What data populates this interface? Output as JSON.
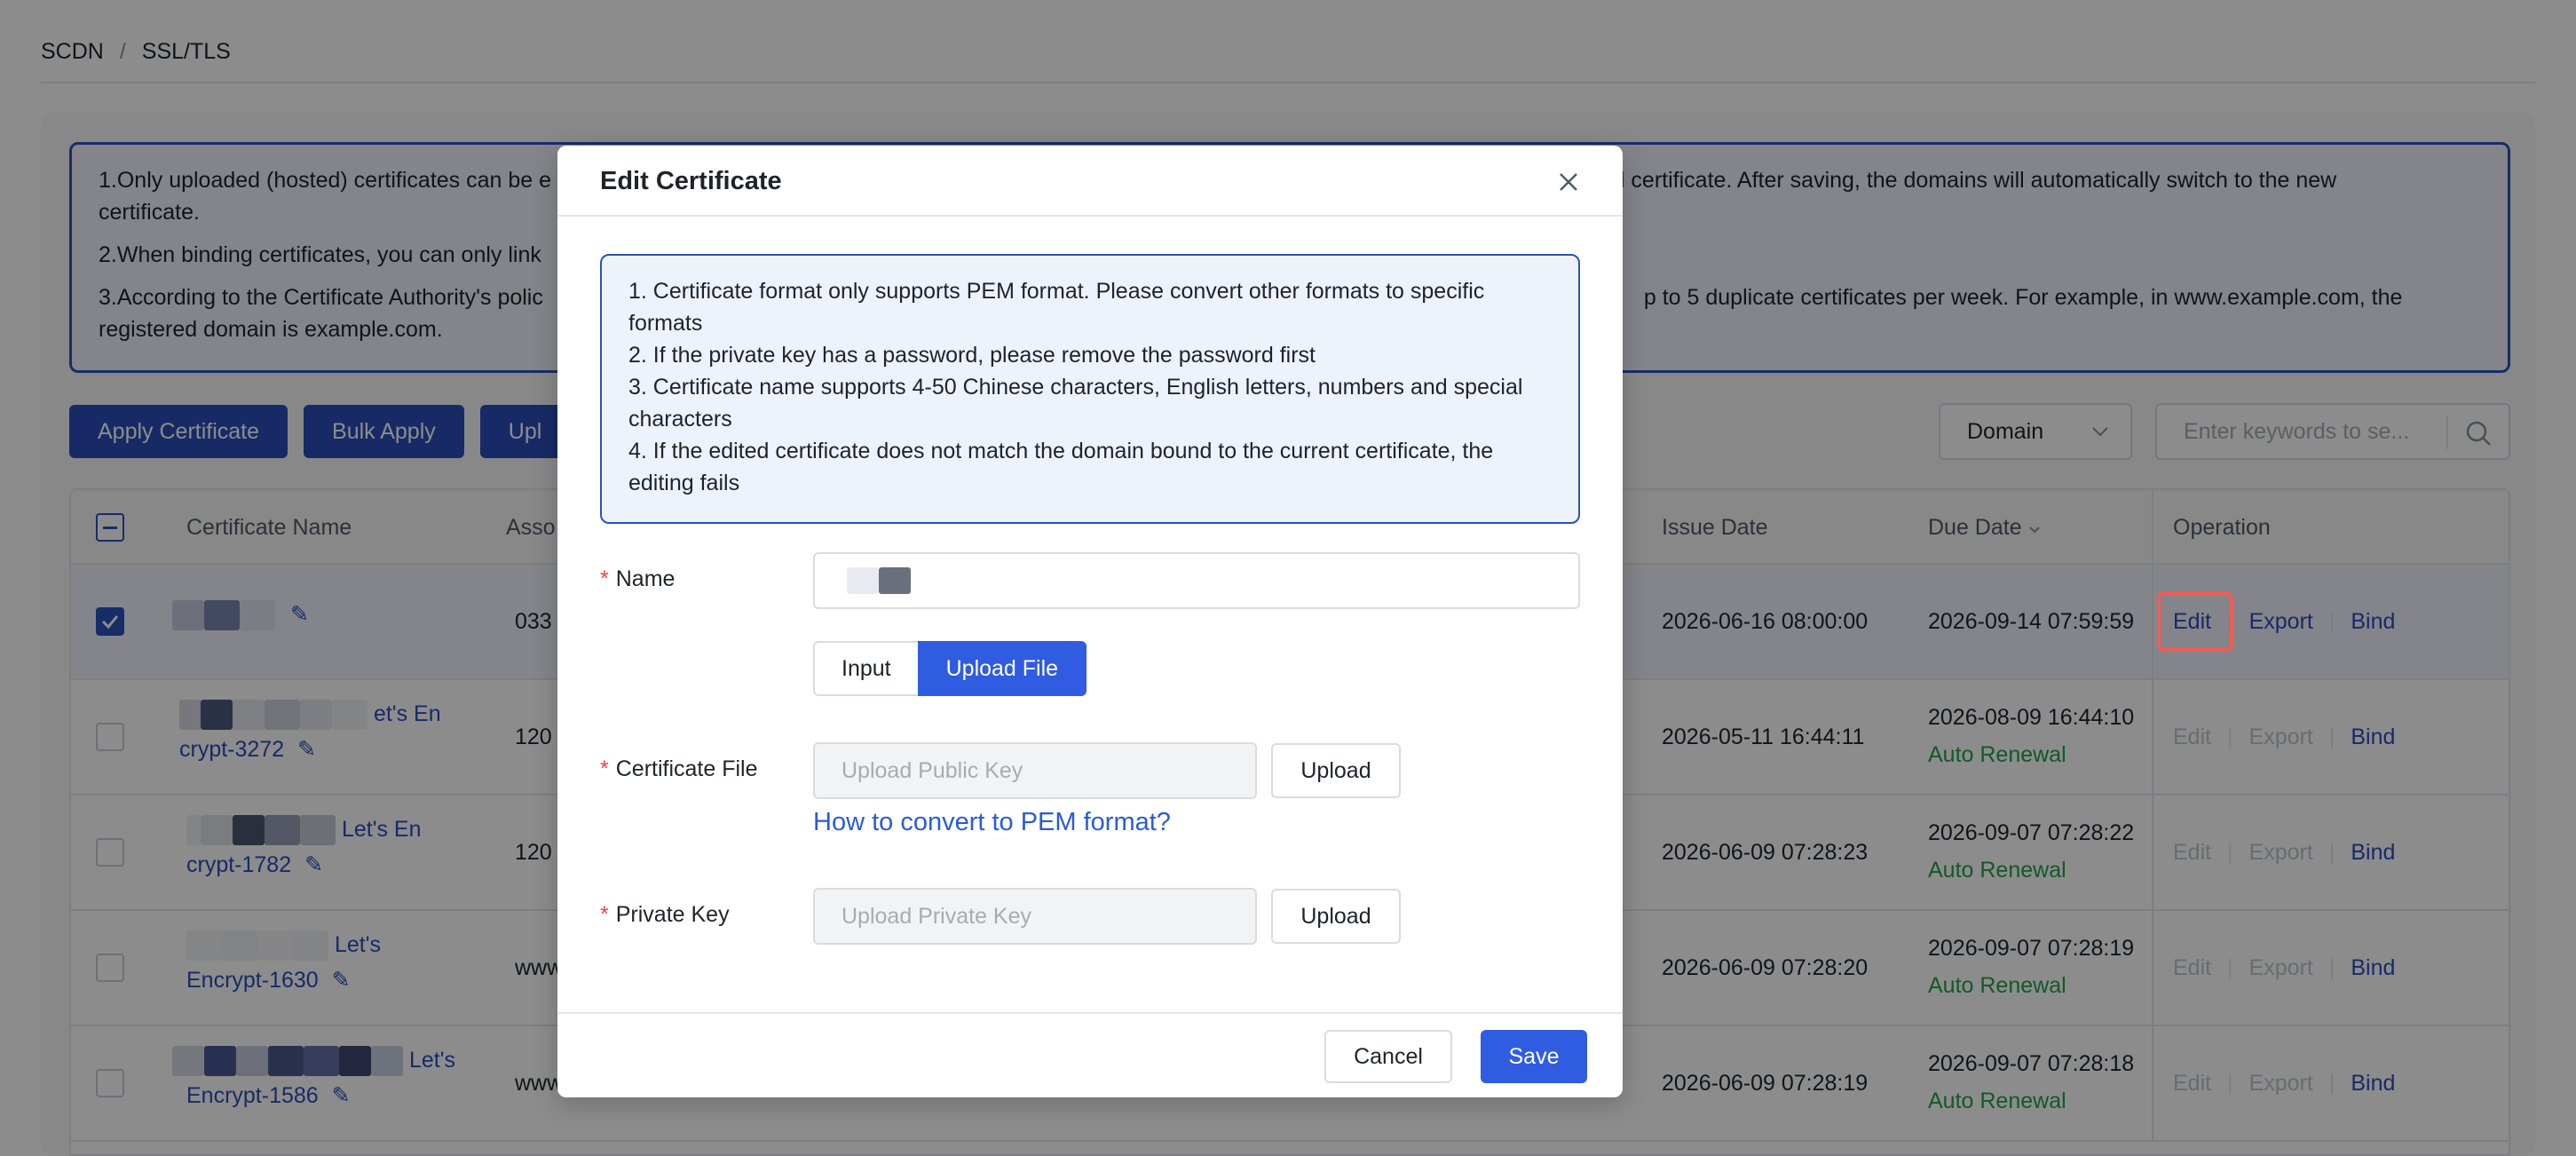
{
  "breadcrumb": {
    "root": "SCDN",
    "separator": "/",
    "current": "SSL/TLS"
  },
  "notice": {
    "line1_start": "1.Only uploaded (hosted) certificates can be e",
    "line1_end": "al certificate. After saving, the domains will automatically switch to the new",
    "line1_cont": "certificate.",
    "line2_start": "2.When binding certificates, you can only link",
    "line3_start": "3.According to the Certificate Authority's polic",
    "line3_end": "p to 5 duplicate certificates per week. For example, in www.example.com, the",
    "line3_cont": "registered domain is example.com."
  },
  "toolbar": {
    "apply_label": "Apply Certificate",
    "bulk_label": "Bulk Apply",
    "upload_label_partial": "Upl",
    "filter_value": "Domain",
    "search_placeholder": "Enter keywords to se..."
  },
  "table": {
    "headers": {
      "name": "Certificate Name",
      "associated": "Asso",
      "issue": "Issue Date",
      "due": "Due Date",
      "operation": "Operation"
    },
    "rows": [
      {
        "name_line1": "",
        "name_line2": "",
        "assoc": "033",
        "issue": "2026-06-16 08:00:00",
        "due": "2026-09-14 07:59:59",
        "renewal": "",
        "edit": "Edit",
        "export": "Export",
        "bind": "Bind",
        "selected": true
      },
      {
        "name_line1": "et's En",
        "name_line2": "crypt-3272",
        "assoc": "120",
        "issue": "2026-05-11 16:44:11",
        "due": "2026-08-09 16:44:10",
        "renewal": "Auto Renewal",
        "edit": "Edit",
        "export": "Export",
        "bind": "Bind",
        "selected": false
      },
      {
        "name_line1": "Let's En",
        "name_line2": "crypt-1782",
        "assoc": "120",
        "issue": "2026-06-09 07:28:23",
        "due": "2026-09-07 07:28:22",
        "renewal": "Auto Renewal",
        "edit": "Edit",
        "export": "Export",
        "bind": "Bind",
        "selected": false
      },
      {
        "name_line1": "Let's",
        "name_line2": "Encrypt-1630",
        "assoc": "www",
        "issue": "2026-06-09 07:28:20",
        "due": "2026-09-07 07:28:19",
        "renewal": "Auto Renewal",
        "edit": "Edit",
        "export": "Export",
        "bind": "Bind",
        "selected": false
      },
      {
        "name_line1": "Let's",
        "name_line2": "Encrypt-1586",
        "assoc": "www",
        "issue": "2026-06-09 07:28:19",
        "due": "2026-09-07 07:28:18",
        "renewal": "Auto Renewal",
        "edit": "Edit",
        "export": "Export",
        "bind": "Bind",
        "selected": false
      }
    ]
  },
  "modal": {
    "title": "Edit Certificate",
    "info": [
      "1. Certificate format only supports PEM format. Please convert other formats to specific formats",
      "2. If the private key has a password, please remove the password first",
      "3. Certificate name supports 4-50 Chinese characters, English letters, numbers and special characters",
      "4. If the edited certificate does not match the domain bound to the current certificate, the editing fails"
    ],
    "required_mark": "*",
    "name_label": "Name",
    "mode_input": "Input",
    "mode_upload": "Upload File",
    "cert_file_label": "Certificate File",
    "cert_file_placeholder": "Upload Public Key",
    "upload_label": "Upload",
    "pem_link": "How to convert to PEM format?",
    "private_key_label": "Private Key",
    "private_key_placeholder": "Upload Private Key",
    "cancel_label": "Cancel",
    "save_label": "Save"
  },
  "colors": {
    "primary": "#2f5ce0",
    "highlight": "#f25c54",
    "success": "#24a148",
    "required": "#f53f3f"
  },
  "icons": {
    "close": "close-icon",
    "search": "search-icon",
    "chevron": "chevron-down-icon",
    "edit": "pencil-icon",
    "sort": "sort-icon"
  }
}
